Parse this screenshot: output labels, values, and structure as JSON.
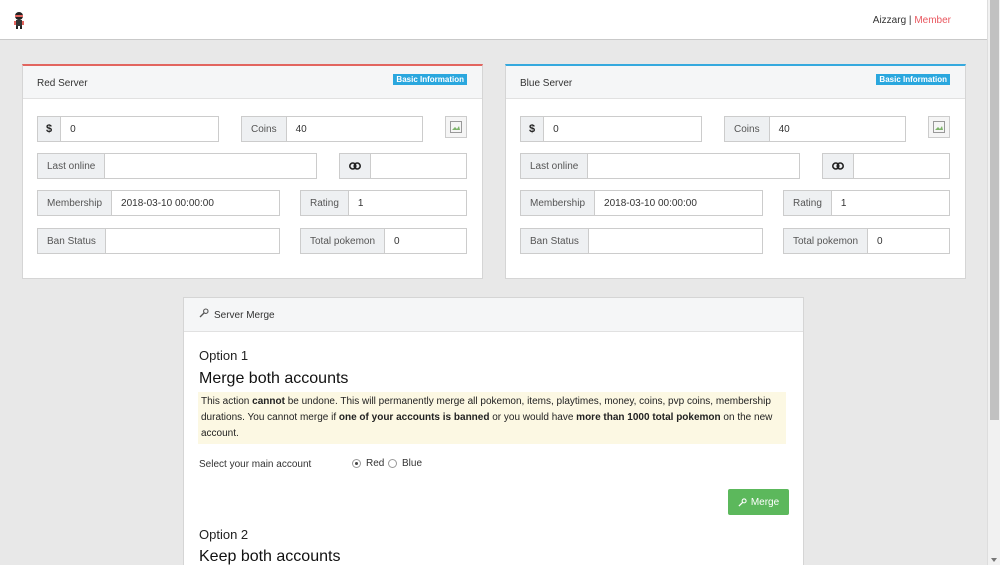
{
  "header": {
    "username": "Aizzarg",
    "separator": "|",
    "role": "Member",
    "role_color": "#e9575f"
  },
  "red_server": {
    "title": "Red Server",
    "badge": "Basic Information",
    "accent": "#e2655f",
    "money_symbol": "$",
    "money": "0",
    "coins_label": "Coins",
    "coins": "40",
    "last_online_label": "Last online",
    "last_online": "",
    "link_icon": "link-icon",
    "link_value": "",
    "membership_label": "Membership",
    "membership": "2018-03-10 00:00:00",
    "rating_label": "Rating",
    "rating": "1",
    "ban_label": "Ban Status",
    "ban": "",
    "total_label": "Total pokemon",
    "total": "0"
  },
  "blue_server": {
    "title": "Blue Server",
    "badge": "Basic Information",
    "accent": "#35a9de",
    "money_symbol": "$",
    "money": "0",
    "coins_label": "Coins",
    "coins": "40",
    "last_online_label": "Last online",
    "last_online": "",
    "link_icon": "link-icon",
    "link_value": "",
    "membership_label": "Membership",
    "membership": "2018-03-10 00:00:00",
    "rating_label": "Rating",
    "rating": "1",
    "ban_label": "Ban Status",
    "ban": "",
    "total_label": "Total pokemon",
    "total": "0"
  },
  "merge": {
    "title": "Server Merge",
    "title_icon": "wrench-icon",
    "option1_label": "Option 1",
    "option1_title": "Merge both accounts",
    "warn_1": "This action ",
    "warn_b1": "cannot",
    "warn_2": " be undone. This will permanently merge all pokemon, items, playtimes, money, coins, pvp coins, membership durations. You cannot merge if ",
    "warn_b2": "one of your accounts is banned",
    "warn_3": " or you would have ",
    "warn_b3": "more than 1000 total pokemon",
    "warn_4": " on the new account.",
    "select_label": "Select your main account",
    "radio_red": "Red",
    "radio_blue": "Blue",
    "selected": "Red",
    "merge_button": "Merge",
    "merge_button_color": "#5cb85c",
    "option2_label": "Option 2",
    "option2_title": "Keep both accounts"
  }
}
